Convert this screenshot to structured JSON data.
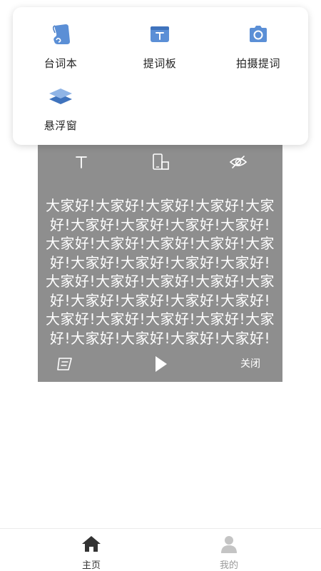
{
  "menu": {
    "items": [
      {
        "label": "台词本",
        "icon": "scroll-icon"
      },
      {
        "label": "提词板",
        "icon": "text-board-icon"
      },
      {
        "label": "拍摄提词",
        "icon": "camera-icon"
      },
      {
        "label": "悬浮窗",
        "icon": "layers-icon"
      }
    ],
    "accent_color": "#5b8fd6"
  },
  "prompter": {
    "background_color": "#8e8e8e",
    "tools": [
      "text-size-icon",
      "rotate-screen-icon",
      "hide-eye-icon"
    ],
    "script_text": "大家好!大家好!大家好!大家好!大家好!大家好!大家好!大家好!大家好!大家好!大家好!大家好!大家好!大家好!大家好!大家好!大家好!大家好!大家好!大家好!大家好!大家好!大家好!大家好!大家好!大家好!大家好!大家好!大家好!大家好!大家好!大家好!大家好!大家好!大家好!大家好!大家好!大家好!",
    "close_label": "关闭"
  },
  "tabbar": {
    "home_label": "主页",
    "mine_label": "我的",
    "active_color": "#333333",
    "inactive_color": "#9a9a9a"
  }
}
